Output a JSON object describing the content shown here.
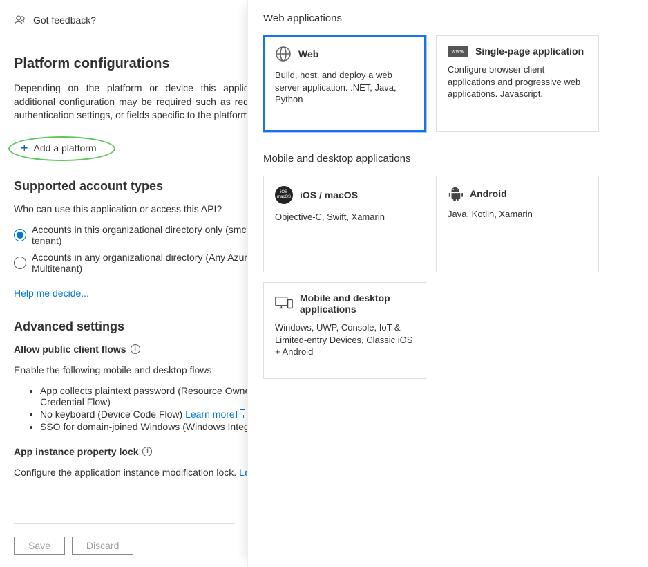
{
  "feedback": {
    "label": "Got feedback?"
  },
  "platform": {
    "heading": "Platform configurations",
    "desc": "Depending on the platform or device this application is targeting, additional configuration may be required such as redirect URIs, specific authentication settings, or fields specific to the platform.",
    "add_label": "Add a platform"
  },
  "accounts": {
    "heading": "Supported account types",
    "question": "Who can use this application or access this API?",
    "opts": [
      "Accounts in this organizational directory only (smctest only - Single tenant)",
      "Accounts in any organizational directory (Any Azure AD directory - Multitenant)"
    ],
    "help": "Help me decide..."
  },
  "advanced": {
    "heading": "Advanced settings",
    "flows_label": "Allow public client flows",
    "flows_desc": "Enable the following mobile and desktop flows:",
    "flows": [
      "App collects plaintext password (Resource Owner Password Credential Flow)",
      {
        "pre": "No keyboard (Device Code Flow) ",
        "link": "Learn more"
      },
      "SSO for domain-joined Windows (Windows Integrated Auth Flow)"
    ],
    "lock_label": "App instance property lock",
    "lock_desc_pre": "Configure the application instance modification lock. ",
    "lock_link": "Learn more"
  },
  "footer": {
    "save": "Save",
    "discard": "Discard"
  },
  "panel": {
    "sec_web": "Web applications",
    "sec_mobile": "Mobile and desktop applications",
    "cards": {
      "web": {
        "title": "Web",
        "desc": "Build, host, and deploy a web server application. .NET, Java, Python"
      },
      "spa": {
        "title": "Single-page application",
        "desc": "Configure browser client applications and progressive web applications. Javascript."
      },
      "ios": {
        "title": "iOS / macOS",
        "desc": "Objective-C, Swift, Xamarin"
      },
      "android": {
        "title": "Android",
        "desc": "Java, Kotlin, Xamarin"
      },
      "desktop": {
        "title": "Mobile and desktop applications",
        "desc": "Windows, UWP, Console, IoT & Limited-entry Devices, Classic iOS + Android"
      }
    }
  }
}
